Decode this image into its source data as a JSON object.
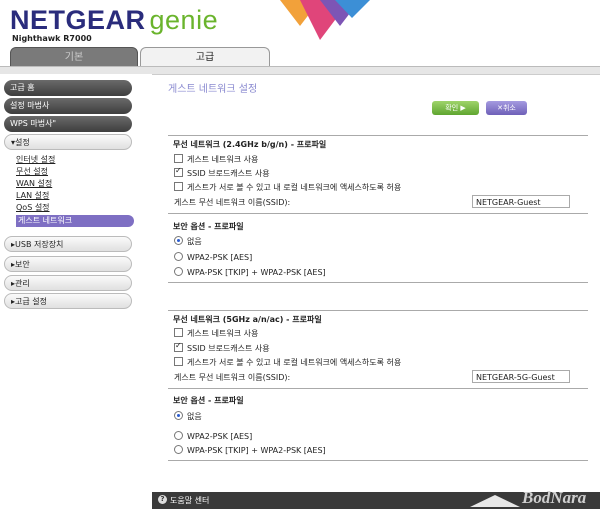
{
  "brand": {
    "name": "NETGEAR",
    "genie": "genie",
    "model": "Nighthawk R7000"
  },
  "tabs": {
    "basic": "기본",
    "advanced": "고급"
  },
  "sidebar": {
    "top": [
      "고급 홈",
      "설정 마법사",
      "WPS 마법사\""
    ],
    "setup_header": "▾설정",
    "subitems": [
      "인터넷 설정",
      "무선 설정",
      "WAN 설정",
      "LAN 설정",
      "QoS 설정"
    ],
    "active_sub": "게스트 네트워크",
    "groups": [
      "▸USB 저장장치",
      "▸보안",
      "▸관리",
      "▸고급 설정"
    ]
  },
  "main": {
    "title": "게스트 네트워크 설정",
    "apply": "확인 ▶",
    "cancel": "✕취소",
    "band24": {
      "header": "무선 네트워크 (2.4GHz b/g/n) - 프로파일",
      "enable_guest": "게스트 네트워크 사용",
      "ssid_broadcast": "SSID 브로드캐스트 사용",
      "allow_local": "게스트가 서로 볼 수 있고 내 로컬 네트워크에 액세스하도록 허용",
      "ssid_label": "게스트 무선 네트워크 이름(SSID):",
      "ssid_value": "NETGEAR-Guest",
      "security_header": "보안 옵션 - 프로파일",
      "sec_none": "없음",
      "sec_wpa2": "WPA2-PSK [AES]",
      "sec_mixed": "WPA-PSK [TKIP] + WPA2-PSK [AES]"
    },
    "band5": {
      "header": "무선 네트워크 (5GHz a/n/ac) - 프로파일",
      "enable_guest": "게스트 네트워크 사용",
      "ssid_broadcast": "SSID 브로드캐스트 사용",
      "allow_local": "게스트가 서로 볼 수 있고 내 로컬 네트워크에 액세스하도록 허용",
      "ssid_label": "게스트 무선 네트워크 이름(SSID):",
      "ssid_value": "NETGEAR-5G-Guest",
      "security_header": "보안 옵션 - 프로파일",
      "sec_none": "없음",
      "sec_wpa2": "WPA2-PSK [AES]",
      "sec_mixed": "WPA-PSK [TKIP] + WPA2-PSK [AES]"
    }
  },
  "footer": {
    "help": "도움말 센터",
    "watermark": "BodNara"
  }
}
